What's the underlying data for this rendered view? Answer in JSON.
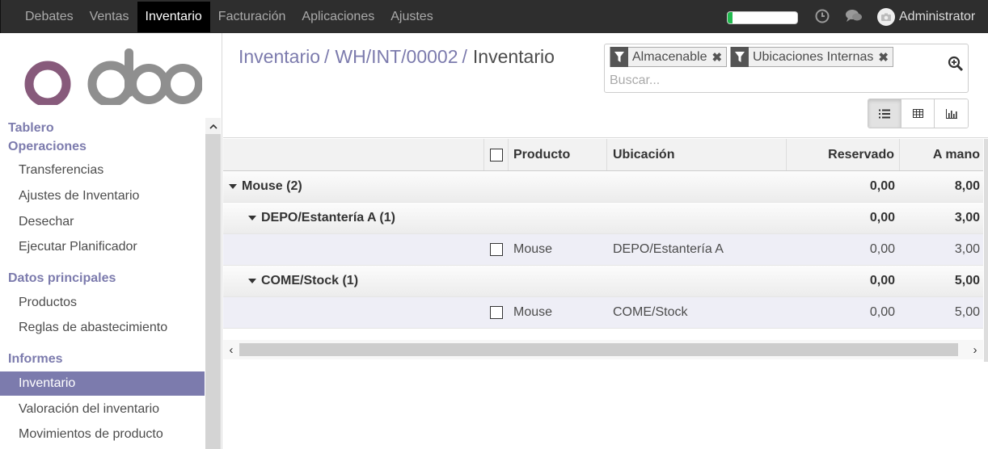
{
  "topbar": {
    "menu": [
      "Debates",
      "Ventas",
      "Inventario",
      "Facturación",
      "Aplicaciones",
      "Ajustes"
    ],
    "active_index": 2,
    "progress": 0.07,
    "user": "Administrator"
  },
  "sidebar": {
    "logo": "odoo",
    "tablero": "Tablero",
    "operaciones": "Operaciones",
    "operaciones_items": [
      "Transferencias",
      "Ajustes de Inventario",
      "Desechar",
      "Ejecutar Planificador"
    ],
    "datos": "Datos principales",
    "datos_items": [
      "Productos",
      "Reglas de abastecimiento"
    ],
    "informes": "Informes",
    "informes_items": [
      "Inventario",
      "Valoración del inventario",
      "Movimientos de producto"
    ]
  },
  "breadcrumb": {
    "b1": "Inventario",
    "b2": "WH/INT/00002",
    "sep": "/",
    "current": "Inventario"
  },
  "search": {
    "facets": [
      "Almacenable",
      "Ubicaciones Internas"
    ],
    "placeholder": "Buscar..."
  },
  "table": {
    "headers": {
      "producto": "Producto",
      "ubicacion": "Ubicación",
      "reservado": "Reservado",
      "a_mano": "A mano"
    },
    "rows": [
      {
        "label": "Mouse (2)",
        "reservado": "0,00",
        "a_mano": "8,00"
      },
      {
        "label": "DEPO/Estantería A (1)",
        "reservado": "0,00",
        "a_mano": "3,00"
      },
      {
        "producto": "Mouse",
        "ubicacion": "DEPO/Estantería A",
        "reservado": "0,00",
        "a_mano": "3,00"
      },
      {
        "label": "COME/Stock (1)",
        "reservado": "0,00",
        "a_mano": "5,00"
      },
      {
        "producto": "Mouse",
        "ubicacion": "COME/Stock",
        "reservado": "0,00",
        "a_mano": "5,00"
      }
    ]
  }
}
